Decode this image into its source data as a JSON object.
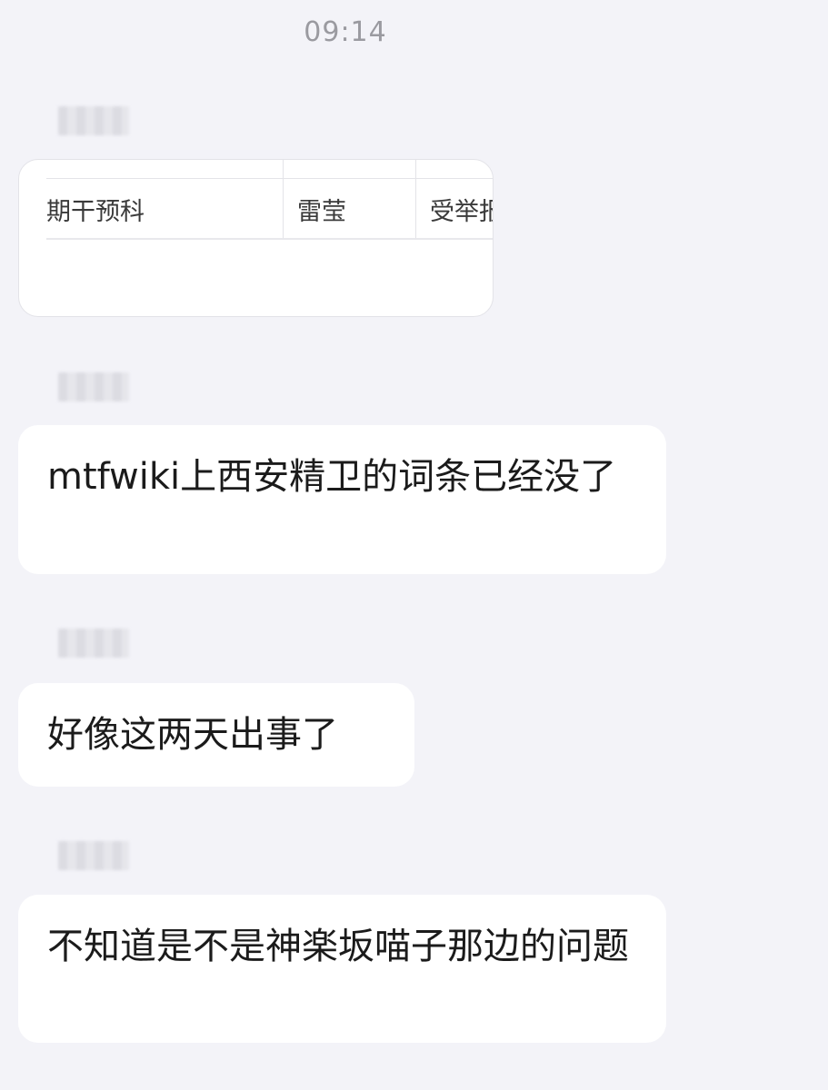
{
  "header": {
    "timestamp": "09:14"
  },
  "messages": [
    {
      "type": "image",
      "table_cells": [
        "期干预科",
        "雷莹",
        "受举报"
      ]
    },
    {
      "type": "text",
      "text": "mtfwiki上西安精卫的词条已经没了"
    },
    {
      "type": "text",
      "text": "好像这两天出事了"
    },
    {
      "type": "text",
      "text": "不知道是不是神楽坂喵子那边的问题"
    }
  ]
}
